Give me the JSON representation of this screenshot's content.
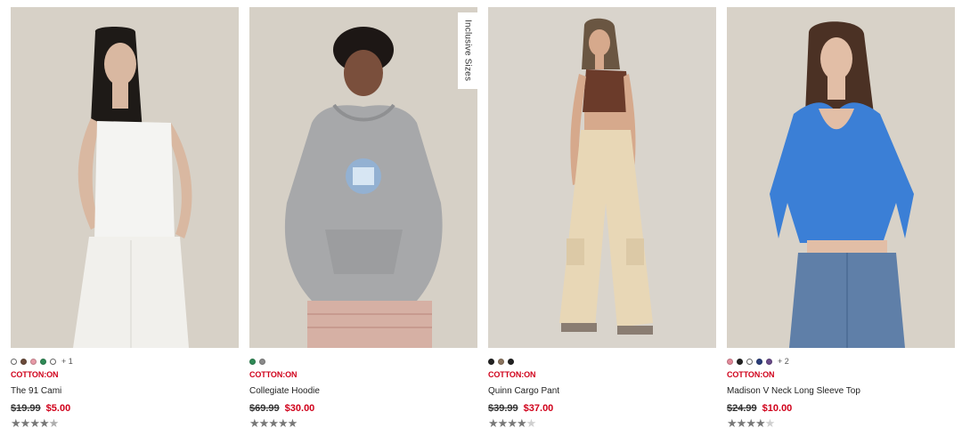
{
  "products": [
    {
      "swatches": [
        "#ffffff",
        "#6b4b3a",
        "#e79aa7",
        "#2f8a56",
        "#ffffff"
      ],
      "more": "+ 1",
      "brand": "COTTON:ON",
      "name": "The 91 Cami",
      "price_original": "$19.99",
      "price_sale": "$5.00",
      "rating": 4.5
    },
    {
      "swatches": [
        "#2f8a56",
        "#8a8a8a"
      ],
      "more": "",
      "brand": "COTTON:ON",
      "name": "Collegiate Hoodie",
      "price_original": "$69.99",
      "price_sale": "$30.00",
      "rating": 5,
      "tag": "Inclusive Sizes"
    },
    {
      "swatches": [
        "#222222",
        "#8b745e",
        "#222222"
      ],
      "more": "",
      "brand": "COTTON:ON",
      "name": "Quinn Cargo Pant",
      "price_original": "$39.99",
      "price_sale": "$37.00",
      "rating": 4
    },
    {
      "swatches": [
        "#e38a9a",
        "#222222",
        "#ffffff",
        "#2a3d7a",
        "#6a4b8a"
      ],
      "more": "+ 2",
      "brand": "COTTON:ON",
      "name": "Madison V Neck Long Sleeve Top",
      "price_original": "$24.99",
      "price_sale": "$10.00",
      "rating": 4
    }
  ]
}
